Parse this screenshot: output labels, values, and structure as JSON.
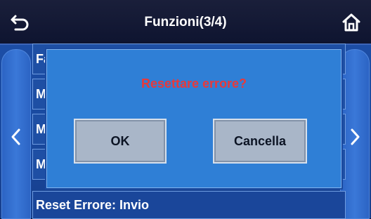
{
  "header": {
    "title": "Funzioni(3/4)",
    "back_icon": "back-arrow-icon",
    "home_icon": "home-icon"
  },
  "list": {
    "items": [
      {
        "label": "Fa"
      },
      {
        "label": "M"
      },
      {
        "label": "M"
      },
      {
        "label": "M"
      },
      {
        "label": "Reset Errore: Invio"
      }
    ]
  },
  "dialog": {
    "title": "Resettare errore?",
    "ok_label": "OK",
    "cancel_label": "Cancella"
  },
  "nav": {
    "prev_icon": "chevron-left-icon",
    "next_icon": "chevron-right-icon"
  },
  "colors": {
    "background": "#1d4fa8",
    "header": "#0e1430",
    "dialog": "#2f7fd6",
    "dialog_title": "#e8393a",
    "button": "#a9b6c8"
  }
}
